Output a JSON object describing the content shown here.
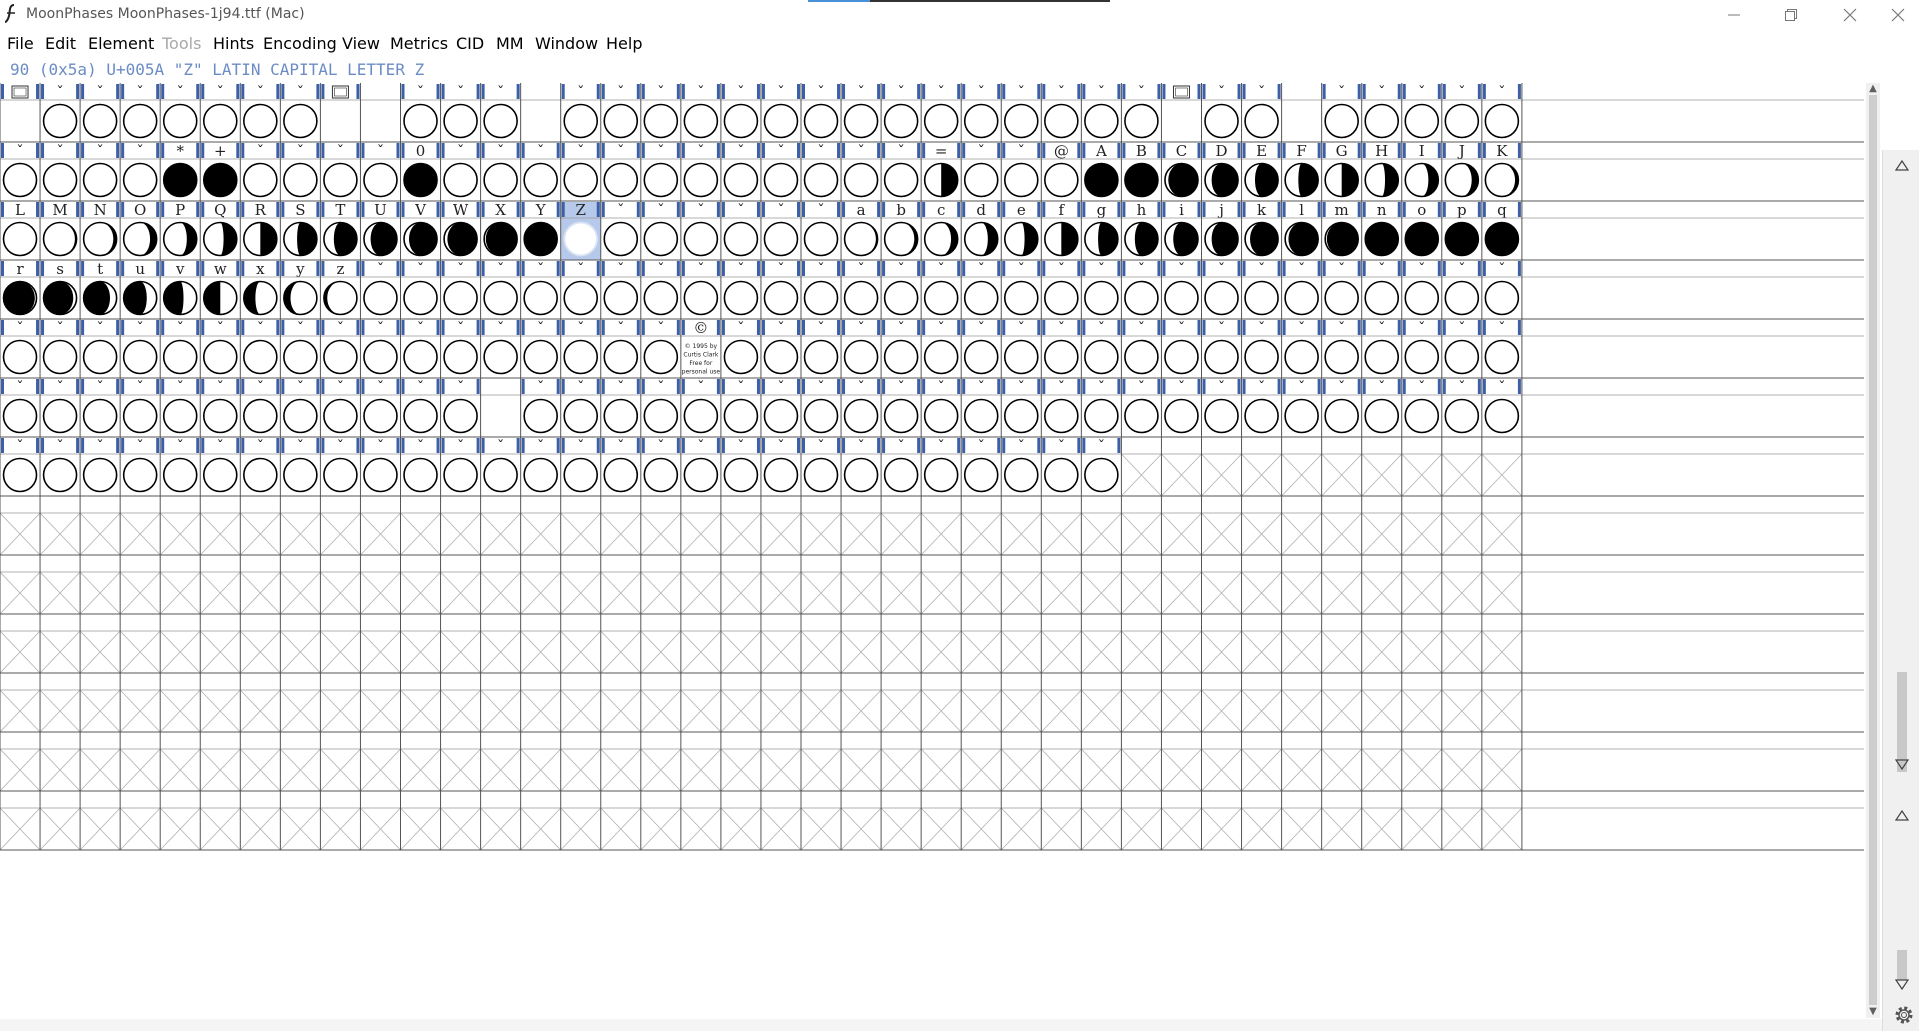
{
  "window": {
    "title": "MoonPhases  MoonPhases-1j94.ttf (Mac)"
  },
  "menu": [
    {
      "label": "File",
      "enabled": true
    },
    {
      "label": "Edit",
      "enabled": true
    },
    {
      "label": "Element",
      "enabled": true
    },
    {
      "label": "Tools",
      "enabled": false
    },
    {
      "label": "Hints",
      "enabled": true
    },
    {
      "label": "Encoding",
      "enabled": true
    },
    {
      "label": "View",
      "enabled": true
    },
    {
      "label": "Metrics",
      "enabled": true
    },
    {
      "label": "CID",
      "enabled": true
    },
    {
      "label": "MM",
      "enabled": true
    },
    {
      "label": "Window",
      "enabled": true
    },
    {
      "label": "Help",
      "enabled": true
    }
  ],
  "status": "90 (0x5a) U+005A \"Z\" LATIN CAPITAL LETTER Z",
  "selected_glyph": "Z",
  "colors": {
    "header_mark": "#3d5fa8",
    "selection": "#b7c9ea",
    "status_text": "#6b8cc4",
    "grid_line": "#555555"
  },
  "icons": {
    "notdef_box": "box-icon",
    "unencoded_mark": "caret-icon",
    "gear": "gear-icon"
  },
  "copyright_lines": [
    "© 1995 by",
    "Curtis Clark",
    "Free for",
    "personal use"
  ],
  "grid": {
    "columns": 38,
    "rows": 13,
    "rows_data": [
      {
        "labels": [
          "■",
          "ˇ",
          "ˇ",
          "ˇ",
          "ˇ",
          "ˇ",
          "ˇ",
          "ˇ",
          "■",
          "",
          "ˇ",
          "ˇ",
          "ˇ",
          "",
          "ˇ",
          "ˇ",
          "ˇ",
          "ˇ",
          "ˇ",
          "ˇ",
          "ˇ",
          "ˇ",
          "ˇ",
          "ˇ",
          "ˇ",
          "ˇ",
          "ˇ",
          "ˇ",
          "ˇ",
          "■",
          "ˇ",
          "ˇ",
          "",
          "ˇ",
          "ˇ",
          "ˇ",
          "ˇ",
          "ˇ"
        ],
        "glyphs": [
          -1,
          0,
          0,
          0,
          0,
          0,
          0,
          0,
          -1,
          -1,
          0,
          0,
          0,
          -1,
          0,
          0,
          0,
          0,
          0,
          0,
          0,
          0,
          0,
          0,
          0,
          0,
          0,
          0,
          0,
          -1,
          0,
          0,
          -1,
          0,
          0,
          0,
          0,
          0
        ]
      },
      {
        "labels": [
          "ˇ",
          "ˇ",
          "ˇ",
          "ˇ",
          "*",
          "+",
          "ˇ",
          "ˇ",
          "ˇ",
          "ˇ",
          "0",
          "ˇ",
          "ˇ",
          "ˇ",
          "ˇ",
          "ˇ",
          "ˇ",
          "ˇ",
          "ˇ",
          "ˇ",
          "ˇ",
          "ˇ",
          "ˇ",
          "=",
          "ˇ",
          "ˇ",
          "@",
          "A",
          "B",
          "C",
          "D",
          "E",
          "F",
          "G",
          "H",
          "I",
          "J",
          "K"
        ],
        "glyphs": [
          0,
          0,
          0,
          0,
          1,
          1,
          0,
          0,
          0,
          0,
          1,
          0,
          0,
          0,
          0,
          0,
          0,
          0,
          0,
          0,
          0,
          0,
          0,
          0.5,
          0,
          0,
          0,
          1,
          1,
          0.9,
          0.8,
          0.7,
          0.6,
          0.5,
          0.4,
          0.3,
          0.2,
          0.1
        ]
      },
      {
        "labels": [
          "L",
          "M",
          "N",
          "O",
          "P",
          "Q",
          "R",
          "S",
          "T",
          "U",
          "V",
          "W",
          "X",
          "Y",
          "Z",
          "ˇ",
          "ˇ",
          "ˇ",
          "ˇ",
          "ˇ",
          "ˇ",
          "a",
          "b",
          "c",
          "d",
          "e",
          "f",
          "g",
          "h",
          "i",
          "j",
          "k",
          "l",
          "m",
          "n",
          "o",
          "p",
          "q"
        ],
        "glyphs": [
          0,
          0.05,
          0.1,
          0.2,
          0.3,
          0.4,
          0.5,
          0.6,
          0.7,
          0.8,
          0.85,
          0.9,
          0.95,
          1,
          0,
          0,
          0,
          0,
          0,
          0,
          0,
          0.05,
          0.1,
          0.2,
          0.3,
          0.4,
          0.5,
          0.6,
          0.7,
          0.75,
          0.8,
          0.85,
          0.9,
          0.95,
          1,
          1,
          1,
          1
        ]
      },
      {
        "labels": [
          "r",
          "s",
          "t",
          "u",
          "v",
          "w",
          "x",
          "y",
          "z",
          "ˇ",
          "ˇ",
          "ˇ",
          "ˇ",
          "ˇ",
          "ˇ",
          "ˇ",
          "ˇ",
          "ˇ",
          "ˇ",
          "ˇ",
          "ˇ",
          "ˇ",
          "ˇ",
          "ˇ",
          "ˇ",
          "ˇ",
          "ˇ",
          "ˇ",
          "ˇ",
          "ˇ",
          "ˇ",
          "ˇ",
          "ˇ",
          "ˇ",
          "ˇ",
          "ˇ",
          "ˇ",
          "ˇ"
        ],
        "glyphs": [
          -0.95,
          -0.9,
          -0.8,
          -0.7,
          -0.6,
          -0.5,
          -0.35,
          -0.2,
          -0.1,
          0,
          0,
          0,
          0,
          0,
          0,
          0,
          0,
          0,
          0,
          0,
          0,
          0,
          0,
          0,
          0,
          0,
          0,
          0,
          0,
          0,
          0,
          0,
          0,
          0,
          0,
          0,
          0,
          0
        ]
      },
      {
        "labels": [
          "ˇ",
          "ˇ",
          "ˇ",
          "ˇ",
          "ˇ",
          "ˇ",
          "ˇ",
          "ˇ",
          "ˇ",
          "ˇ",
          "ˇ",
          "ˇ",
          "ˇ",
          "ˇ",
          "ˇ",
          "ˇ",
          "ˇ",
          "©",
          "ˇ",
          "ˇ",
          "ˇ",
          "ˇ",
          "ˇ",
          "ˇ",
          "ˇ",
          "ˇ",
          "ˇ",
          "ˇ",
          "ˇ",
          "ˇ",
          "ˇ",
          "ˇ",
          "ˇ",
          "ˇ",
          "ˇ",
          "ˇ",
          "ˇ",
          "ˇ"
        ],
        "glyphs": [
          0,
          0,
          0,
          0,
          0,
          0,
          0,
          0,
          0,
          0,
          0,
          0,
          0,
          0,
          0,
          0,
          0,
          "c",
          0,
          0,
          0,
          0,
          0,
          0,
          0,
          0,
          0,
          0,
          0,
          0,
          0,
          0,
          0,
          0,
          0,
          0,
          0,
          0
        ]
      },
      {
        "labels": [
          "ˇ",
          "ˇ",
          "ˇ",
          "ˇ",
          "ˇ",
          "ˇ",
          "ˇ",
          "ˇ",
          "ˇ",
          "ˇ",
          "ˇ",
          "ˇ",
          "",
          "ˇ",
          "ˇ",
          "ˇ",
          "ˇ",
          "ˇ",
          "ˇ",
          "ˇ",
          "ˇ",
          "ˇ",
          "ˇ",
          "ˇ",
          "ˇ",
          "ˇ",
          "ˇ",
          "ˇ",
          "ˇ",
          "ˇ",
          "ˇ",
          "ˇ",
          "ˇ",
          "ˇ",
          "ˇ",
          "ˇ",
          "ˇ",
          "ˇ"
        ],
        "glyphs": [
          0,
          0,
          0,
          0,
          0,
          0,
          0,
          0,
          0,
          0,
          0,
          0,
          -1,
          0,
          0,
          0,
          0,
          0,
          0,
          0,
          0,
          0,
          0,
          0,
          0,
          0,
          0,
          0,
          0,
          0,
          0,
          0,
          0,
          0,
          0,
          0,
          0,
          0
        ]
      },
      {
        "labels": [
          "ˇ",
          "ˇ",
          "ˇ",
          "ˇ",
          "ˇ",
          "ˇ",
          "ˇ",
          "ˇ",
          "ˇ",
          "ˇ",
          "ˇ",
          "ˇ",
          "ˇ",
          "ˇ",
          "ˇ",
          "ˇ",
          "ˇ",
          "ˇ",
          "ˇ",
          "ˇ",
          "ˇ",
          "ˇ",
          "ˇ",
          "ˇ",
          "ˇ",
          "ˇ",
          "ˇ",
          "ˇ"
        ],
        "glyphs": [
          0,
          0,
          0,
          0,
          0,
          0,
          0,
          0,
          0,
          0,
          0,
          0,
          0,
          0,
          0,
          0,
          0,
          0,
          0,
          0,
          0,
          0,
          0,
          0,
          0,
          0,
          0,
          0
        ]
      }
    ]
  }
}
